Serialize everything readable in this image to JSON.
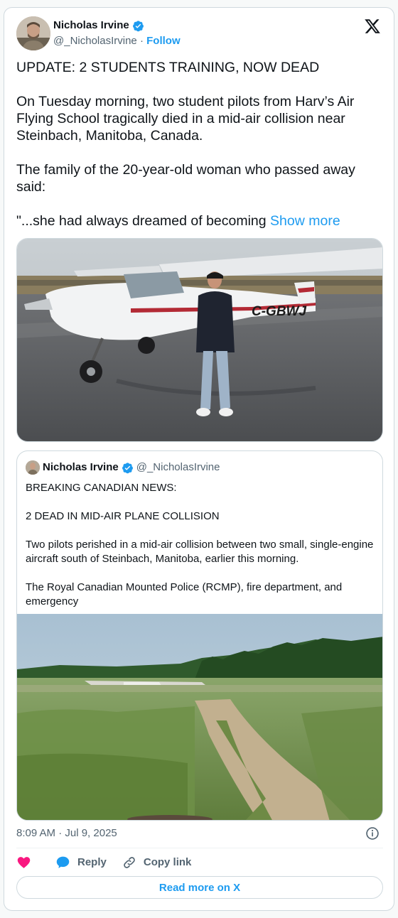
{
  "author": {
    "name": "Nicholas Irvine",
    "handle": "@_NicholasIrvine",
    "separator": "·",
    "follow_label": "Follow"
  },
  "tweet": {
    "text": "UPDATE: 2 STUDENTS TRAINING, NOW DEAD\n\nOn Tuesday morning, two student pilots from Harv’s Air Flying School tragically died in a mid-air collision near Steinbach, Manitoba, Canada.\n\nThe family of the 20-year-old woman who passed away said:\n\n\"...she had always dreamed of becoming ",
    "show_more_label": "Show more",
    "media_registration": "C-GBWJ"
  },
  "quote": {
    "name": "Nicholas Irvine",
    "handle": "@_NicholasIrvine",
    "text": "BREAKING CANADIAN NEWS:\n\n2 DEAD IN MID-AIR PLANE COLLISION\n\nTwo pilots perished in a mid-air collision between two small, single-engine aircraft south of Steinbach, Manitoba, earlier this morning.\n\nThe Royal Canadian Mounted Police (RCMP), fire department, and emergency"
  },
  "footer": {
    "timestamp": "8:09 AM · Jul 9, 2025",
    "reply_label": "Reply",
    "copy_link_label": "Copy link",
    "read_more_label": "Read more on X"
  },
  "colors": {
    "accent": "#1d9bf0",
    "like": "#f91880",
    "text_secondary": "#536471"
  },
  "icons": [
    "verified-badge-icon",
    "x-logo-icon",
    "info-icon",
    "heart-icon",
    "reply-bubble-icon",
    "link-icon"
  ]
}
